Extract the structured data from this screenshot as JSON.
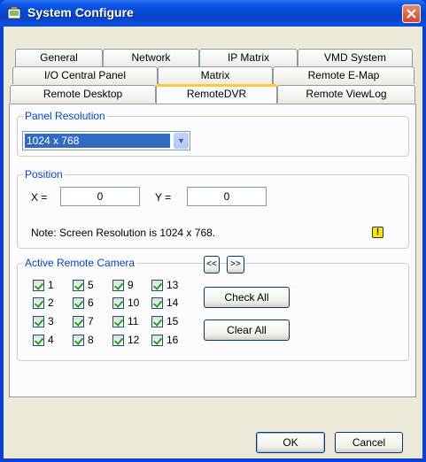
{
  "window": {
    "title": "System Configure"
  },
  "tabs": {
    "row1": [
      "General",
      "Network",
      "IP Matrix",
      "VMD System"
    ],
    "row2": [
      "I/O Central Panel",
      "Matrix",
      "Remote E-Map"
    ],
    "row3": [
      "Remote Desktop",
      "RemoteDVR",
      "Remote ViewLog"
    ],
    "active": "RemoteDVR"
  },
  "panel_resolution": {
    "legend": "Panel Resolution",
    "selected": "1024 x 768"
  },
  "position": {
    "legend": "Position",
    "x_label": "X =",
    "x_value": "0",
    "y_label": "Y =",
    "y_value": "0",
    "note": "Note: Screen Resolution is 1024 x 768.",
    "warning_icon_glyph": "!"
  },
  "camera": {
    "legend": "Active Remote Camera",
    "prev_label": "<<",
    "next_label": ">>",
    "check_all": "Check All",
    "clear_all": "Clear All",
    "items": [
      {
        "label": "1",
        "checked": true
      },
      {
        "label": "5",
        "checked": true
      },
      {
        "label": "9",
        "checked": true
      },
      {
        "label": "13",
        "checked": true
      },
      {
        "label": "2",
        "checked": true
      },
      {
        "label": "6",
        "checked": true
      },
      {
        "label": "10",
        "checked": true
      },
      {
        "label": "14",
        "checked": true
      },
      {
        "label": "3",
        "checked": true
      },
      {
        "label": "7",
        "checked": true
      },
      {
        "label": "11",
        "checked": true
      },
      {
        "label": "15",
        "checked": true
      },
      {
        "label": "4",
        "checked": true
      },
      {
        "label": "8",
        "checked": true
      },
      {
        "label": "12",
        "checked": true
      },
      {
        "label": "16",
        "checked": true
      }
    ]
  },
  "footer": {
    "ok": "OK",
    "cancel": "Cancel"
  },
  "colors": {
    "title_bar": "#0a54e4",
    "accent_legend": "#0046d5",
    "dialog_bg": "#ece9d8"
  }
}
